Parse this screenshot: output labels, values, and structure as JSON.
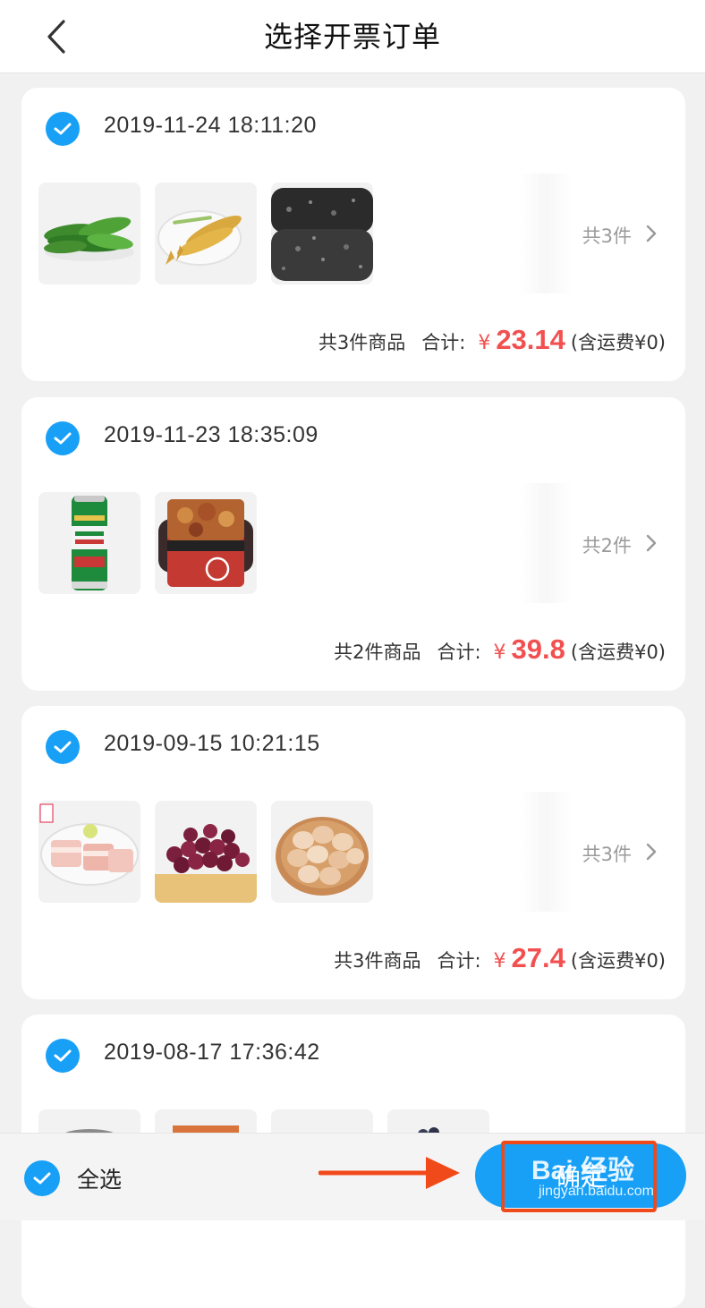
{
  "header": {
    "title": "选择开票订单",
    "back_icon": "chevron-left-icon"
  },
  "orders": [
    {
      "date": "2019-11-24 18:11:20",
      "checked": true,
      "items": [
        "green-beans",
        "yellow-croaker-fish",
        "dark-cake"
      ],
      "count_text": "共3件",
      "goods_text": "共3件商品",
      "total_label": "合计:",
      "currency": "¥",
      "amount": "23.14",
      "shipping_text": "(含运费¥0)"
    },
    {
      "date": "2019-11-23 18:35:09",
      "checked": true,
      "items": [
        "tsingtao-beer-can",
        "self-heating-hotpot"
      ],
      "count_text": "共2件",
      "goods_text": "共2件商品",
      "total_label": "合计:",
      "currency": "¥",
      "amount": "39.8",
      "shipping_text": "(含运费¥0)"
    },
    {
      "date": "2019-09-15 10:21:15",
      "checked": true,
      "items": [
        "pork-belly",
        "red-grapes",
        "eggs"
      ],
      "count_text": "共3件",
      "goods_text": "共3件商品",
      "total_label": "合计:",
      "currency": "¥",
      "amount": "27.4",
      "shipping_text": "(含运费¥0)"
    },
    {
      "date": "2019-08-17 17:36:42",
      "checked": true,
      "items": [
        "product-1",
        "product-2",
        "product-3",
        "product-4"
      ]
    }
  ],
  "bottom_bar": {
    "select_all_label": "全选",
    "select_all_checked": true,
    "confirm_label": "确定"
  },
  "watermark": {
    "top": "Bai 经验",
    "bottom": "jingyan.baidu.com"
  },
  "colors": {
    "accent": "#18a0f7",
    "price": "#f25050",
    "annotation": "#f04a1a",
    "background": "#f1f1f1"
  }
}
